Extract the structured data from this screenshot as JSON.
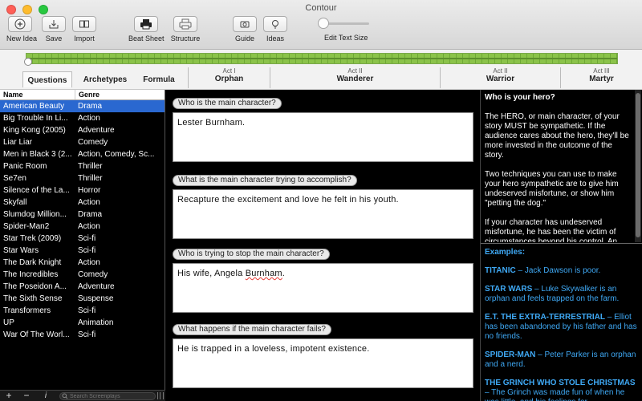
{
  "window": {
    "title": "Contour"
  },
  "toolbar": {
    "items": [
      {
        "label": "New Idea",
        "icon": "plus-icon"
      },
      {
        "label": "Save",
        "icon": "download-tray-icon"
      },
      {
        "label": "Import",
        "icon": "book-icon"
      },
      {
        "label": "Beat Sheet",
        "icon": "printer-icon"
      },
      {
        "label": "Structure",
        "icon": "printer-outline-icon"
      },
      {
        "label": "Guide",
        "icon": "camera-icon"
      },
      {
        "label": "Ideas",
        "icon": "lightbulb-icon"
      }
    ],
    "text_size_label": "Edit Text Size",
    "text_size_level": 0.0
  },
  "timeline": {
    "progress": 0.0,
    "tabs": [
      {
        "label": "Questions",
        "active": true
      },
      {
        "label": "Archetypes",
        "active": false
      },
      {
        "label": "Formula",
        "active": false
      }
    ],
    "acts": [
      {
        "num": "Act I",
        "name": "Orphan"
      },
      {
        "num": "Act II",
        "name": "Wanderer"
      },
      {
        "num": "Act II",
        "name": "Warrior"
      },
      {
        "num": "Act III",
        "name": "Martyr"
      }
    ]
  },
  "list": {
    "headers": {
      "name": "Name",
      "genre": "Genre"
    },
    "selected_index": 0,
    "rows": [
      {
        "name": "American Beauty",
        "genre": "Drama"
      },
      {
        "name": "Big Trouble In Li...",
        "genre": "Action"
      },
      {
        "name": "King Kong (2005)",
        "genre": "Adventure"
      },
      {
        "name": "Liar Liar",
        "genre": "Comedy"
      },
      {
        "name": "Men in Black 3 (2...",
        "genre": "Action, Comedy, Sc..."
      },
      {
        "name": "Panic Room",
        "genre": "Thriller"
      },
      {
        "name": "Se7en",
        "genre": "Thriller"
      },
      {
        "name": "Silence of the La...",
        "genre": "Horror"
      },
      {
        "name": "Skyfall",
        "genre": "Action"
      },
      {
        "name": "Slumdog Million...",
        "genre": "Drama"
      },
      {
        "name": "Spider-Man2",
        "genre": "Action"
      },
      {
        "name": "Star Trek (2009)",
        "genre": "Sci-fi"
      },
      {
        "name": "Star Wars",
        "genre": "Sci-fi"
      },
      {
        "name": "The Dark Knight",
        "genre": "Action"
      },
      {
        "name": "The Incredibles",
        "genre": "Comedy"
      },
      {
        "name": "The Poseidon A...",
        "genre": "Adventure"
      },
      {
        "name": "The Sixth Sense",
        "genre": "Suspense"
      },
      {
        "name": "Transformers",
        "genre": "Sci-fi"
      },
      {
        "name": "UP",
        "genre": "Animation"
      },
      {
        "name": "War Of The Worl...",
        "genre": "Sci-fi"
      }
    ],
    "footer": {
      "add": "+",
      "remove": "−",
      "info": "i",
      "search_placeholder": "Search Screenplays"
    }
  },
  "questions": [
    {
      "question": "Who is the main character?",
      "answer": "Lester Burnham."
    },
    {
      "question": "What is the main character trying to accomplish?",
      "answer": "Recapture the excitement and love he felt in his youth."
    },
    {
      "question": "Who is trying to stop the main character?",
      "answer_prefix": "His wife, Angela ",
      "answer_flagged": "Burnham",
      "answer_suffix": "."
    },
    {
      "question": "What happens if the main character fails?",
      "answer": "He is trapped in a loveless, impotent existence."
    }
  ],
  "info": {
    "heading": "Who is your hero?",
    "paragraphs": [
      "The HERO, or main character, of your story MUST be sympathetic. If the audience cares about the hero, they'll be more invested in the outcome of the story.",
      "Two techniques you can use to make your hero sympathetic are to give him undeserved misfortune, or show him \"petting the dog.\"",
      "If your character has undeserved misfortune, he has been the victim of circumstances beyond his control. An unfaithful spouse, abandonment, the"
    ],
    "examples_heading": "Examples:",
    "examples": [
      {
        "title": "TITANIC",
        "text": " – Jack Dawson is poor."
      },
      {
        "title": "STAR WARS",
        "text": " – Luke Skywalker is an orphan and feels trapped on the farm."
      },
      {
        "title": "E.T. THE EXTRA-TERRESTRIAL",
        "text": " – Elliot has been abandoned by his father and has no friends."
      },
      {
        "title": "SPIDER-MAN",
        "text": " – Peter Parker is an orphan and a nerd."
      },
      {
        "title": "THE GRINCH WHO STOLE CHRISTMAS",
        "text": " – The Grinch was made fun of when he was little, and his feelings for"
      }
    ]
  },
  "colors": {
    "selection": "#2a68d0",
    "timeline_green": "#8bc34a",
    "example_blue": "#3fa9f5"
  }
}
